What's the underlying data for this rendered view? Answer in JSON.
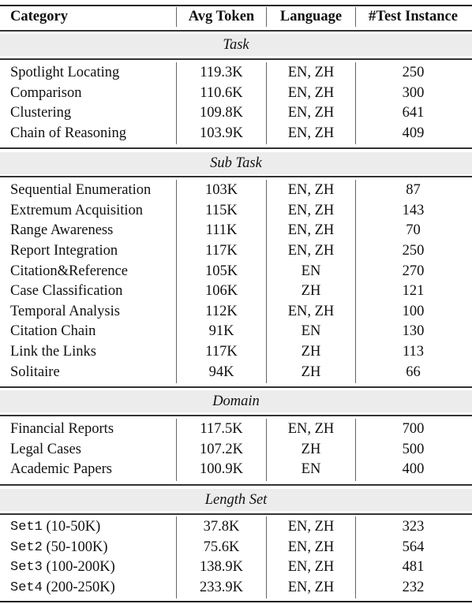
{
  "header": {
    "category": "Category",
    "avg_token": "Avg Token",
    "language": "Language",
    "test_instance": "#Test Instance"
  },
  "sections": [
    {
      "title": "Task",
      "rows": [
        {
          "category": "Spotlight Locating",
          "avg_token": "119.3K",
          "language": "EN, ZH",
          "test_instance": "250"
        },
        {
          "category": "Comparison",
          "avg_token": "110.6K",
          "language": "EN, ZH",
          "test_instance": "300"
        },
        {
          "category": "Clustering",
          "avg_token": "109.8K",
          "language": "EN, ZH",
          "test_instance": "641"
        },
        {
          "category": "Chain of Reasoning",
          "avg_token": "103.9K",
          "language": "EN, ZH",
          "test_instance": "409"
        }
      ]
    },
    {
      "title": "Sub Task",
      "rows": [
        {
          "category": "Sequential Enumeration",
          "avg_token": "103K",
          "language": "EN, ZH",
          "test_instance": "87"
        },
        {
          "category": "Extremum Acquisition",
          "avg_token": "115K",
          "language": "EN, ZH",
          "test_instance": "143"
        },
        {
          "category": "Range Awareness",
          "avg_token": "111K",
          "language": "EN, ZH",
          "test_instance": "70"
        },
        {
          "category": "Report Integration",
          "avg_token": "117K",
          "language": "EN, ZH",
          "test_instance": "250"
        },
        {
          "category": "Citation&Reference",
          "avg_token": "105K",
          "language": "EN",
          "test_instance": "270"
        },
        {
          "category": "Case Classification",
          "avg_token": "106K",
          "language": "ZH",
          "test_instance": "121"
        },
        {
          "category": "Temporal Analysis",
          "avg_token": "112K",
          "language": "EN, ZH",
          "test_instance": "100"
        },
        {
          "category": "Citation Chain",
          "avg_token": "91K",
          "language": "EN",
          "test_instance": "130"
        },
        {
          "category": "Link the Links",
          "avg_token": "117K",
          "language": "ZH",
          "test_instance": "113"
        },
        {
          "category": "Solitaire",
          "avg_token": "94K",
          "language": "ZH",
          "test_instance": "66"
        }
      ]
    },
    {
      "title": "Domain",
      "rows": [
        {
          "category": "Financial Reports",
          "avg_token": "117.5K",
          "language": "EN, ZH",
          "test_instance": "700"
        },
        {
          "category": "Legal Cases",
          "avg_token": "107.2K",
          "language": "ZH",
          "test_instance": "500"
        },
        {
          "category": "Academic Papers",
          "avg_token": "100.9K",
          "language": "EN",
          "test_instance": "400"
        }
      ]
    },
    {
      "title": "Length Set",
      "rows": [
        {
          "category_code": "Set1",
          "category_range": " (10-50K)",
          "avg_token": "37.8K",
          "language": "EN, ZH",
          "test_instance": "323"
        },
        {
          "category_code": "Set2",
          "category_range": " (50-100K)",
          "avg_token": "75.6K",
          "language": "EN, ZH",
          "test_instance": "564"
        },
        {
          "category_code": "Set3",
          "category_range": " (100-200K)",
          "avg_token": "138.9K",
          "language": "EN, ZH",
          "test_instance": "481"
        },
        {
          "category_code": "Set4",
          "category_range": " (200-250K)",
          "avg_token": "233.9K",
          "language": "EN, ZH",
          "test_instance": "232"
        }
      ]
    }
  ]
}
